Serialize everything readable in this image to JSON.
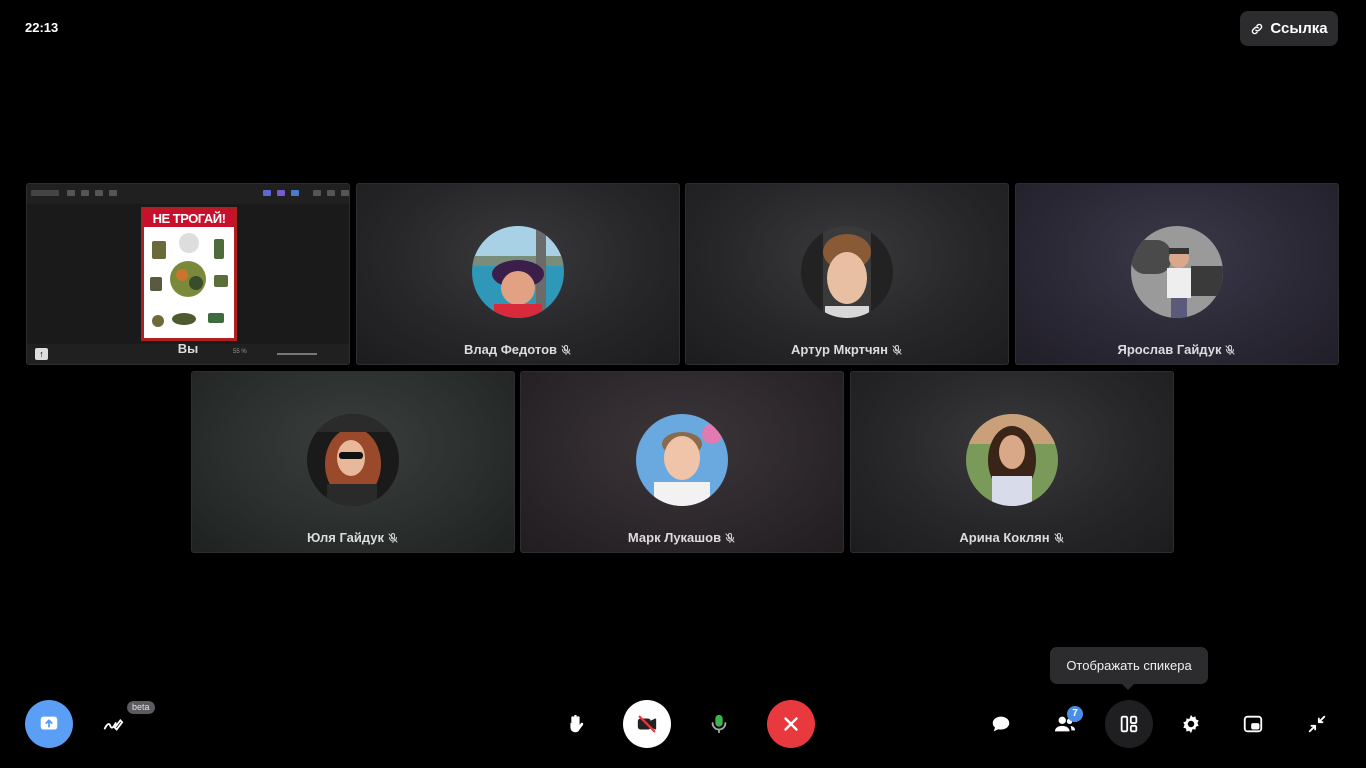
{
  "status": {
    "time": "22:13"
  },
  "header": {
    "link_label": "Ссылка"
  },
  "participants": [
    {
      "name": "Вы",
      "muted": false,
      "screen_share": true
    },
    {
      "name": "Влад Федотов",
      "muted": true
    },
    {
      "name": "Артур Мкртчян",
      "muted": true
    },
    {
      "name": "Ярослав Гайдук",
      "muted": true
    },
    {
      "name": "Юля Гайдук",
      "muted": true
    },
    {
      "name": "Марк Лукашов",
      "muted": true
    },
    {
      "name": "Арина Коклян",
      "muted": true
    }
  ],
  "shared_screen": {
    "poster_title": "НЕ ТРОГАЙ!",
    "zoom": "55 %"
  },
  "toolbar": {
    "beta_label": "beta",
    "participants_count": "7",
    "tooltip": "Отображать спикера"
  },
  "colors": {
    "share_button": "#5a9ef5",
    "end_call": "#e8393f",
    "mic_active": "#3cb44b",
    "badge": "#4a8fe7"
  },
  "icons": [
    "link-icon",
    "mic-off-icon",
    "screen-share-icon",
    "whiteboard-icon",
    "raise-hand-icon",
    "camera-off-icon",
    "mic-icon",
    "end-call-icon",
    "chat-icon",
    "participants-icon",
    "layout-icon",
    "settings-icon",
    "pip-icon",
    "minimize-icon"
  ]
}
